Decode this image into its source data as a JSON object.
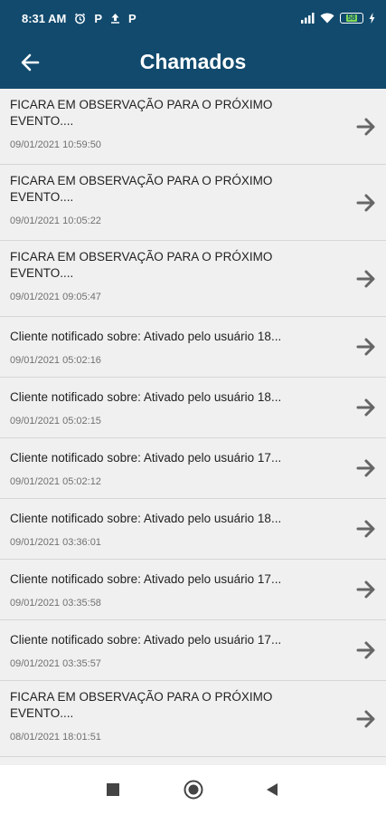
{
  "status_bar": {
    "time": "8:31 AM",
    "battery_level": "58",
    "icons": [
      "alarm-icon",
      "p-notification-icon",
      "upload-icon",
      "p-notification-icon",
      "signal-icon",
      "wifi-icon",
      "battery-icon",
      "charging-icon"
    ],
    "battery_color": "#7ed957"
  },
  "app_bar": {
    "title": "Chamados",
    "color": "#114a6d"
  },
  "items": [
    {
      "title": "FICARA EM OBSERVAÇÃO PARA O PRÓXIMO\nEVENTO....",
      "date": "09/01/2021 10:59:50"
    },
    {
      "title": "FICARA EM OBSERVAÇÃO PARA O PRÓXIMO\nEVENTO....",
      "date": "09/01/2021 10:05:22"
    },
    {
      "title": "FICARA EM OBSERVAÇÃO PARA O PRÓXIMO\nEVENTO....",
      "date": "09/01/2021 09:05:47"
    },
    {
      "title": "Cliente notificado sobre: Ativado pelo usuário 18...",
      "date": "09/01/2021 05:02:16"
    },
    {
      "title": "Cliente notificado sobre: Ativado pelo usuário 18...",
      "date": "09/01/2021 05:02:15"
    },
    {
      "title": "Cliente notificado sobre: Ativado pelo usuário 17...",
      "date": "09/01/2021 05:02:12"
    },
    {
      "title": "Cliente notificado sobre: Ativado pelo usuário 18...",
      "date": "09/01/2021 03:36:01"
    },
    {
      "title": "Cliente notificado sobre: Ativado pelo usuário 17...",
      "date": "09/01/2021 03:35:58"
    },
    {
      "title": "Cliente notificado sobre: Ativado pelo usuário 17...",
      "date": "09/01/2021 03:35:57"
    },
    {
      "title": "FICARA EM OBSERVAÇÃO PARA O PRÓXIMO\nEVENTO....",
      "date": "08/01/2021 18:01:51"
    }
  ],
  "nav_bar": {
    "buttons": [
      "recents-square-icon",
      "home-circle-icon",
      "back-triangle-icon"
    ]
  }
}
